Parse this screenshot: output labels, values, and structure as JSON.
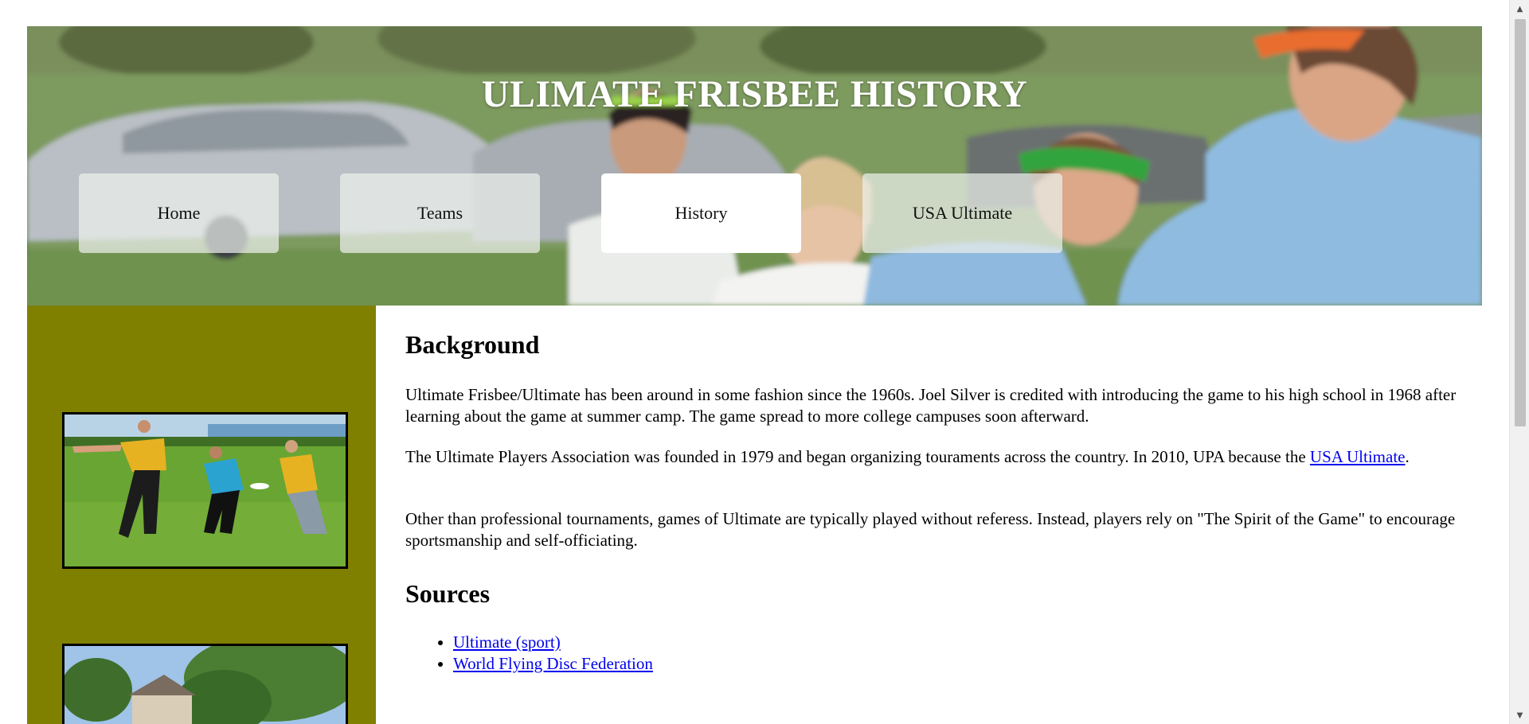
{
  "banner": {
    "title": "ULIMATE FRISBEE HISTORY"
  },
  "nav": {
    "items": [
      {
        "label": "Home",
        "active": false
      },
      {
        "label": "Teams",
        "active": false
      },
      {
        "label": "History",
        "active": true
      },
      {
        "label": "USA Ultimate",
        "active": false
      }
    ]
  },
  "sidebar": {
    "background_color": "#808000"
  },
  "content": {
    "background_heading": "Background",
    "paragraph1": "Ultimate Frisbee/Ultimate has been around in some fashion since the 1960s. Joel Silver is credited with introducing the game to his high school in 1968 after learning about the game at summer camp. The game spread to more college campuses soon afterward.",
    "paragraph2_text": "The Ultimate Players Association was founded in 1979 and began organizing touraments across the country. In 2010, UPA because the ",
    "paragraph2_link": "USA Ultimate",
    "paragraph2_end": ".",
    "paragraph3": "Other than professional tournaments, games of Ultimate are typically played without referess. Instead, players rely on \"The Spirit of the Game\" to encourage sportsmanship and self-officiating.",
    "sources_heading": "Sources",
    "sources": [
      {
        "label": "Ultimate (sport)"
      },
      {
        "label": "World Flying Disc Federation"
      }
    ]
  },
  "colors": {
    "link": "#0000ee",
    "nav_active": "#ffffff"
  }
}
